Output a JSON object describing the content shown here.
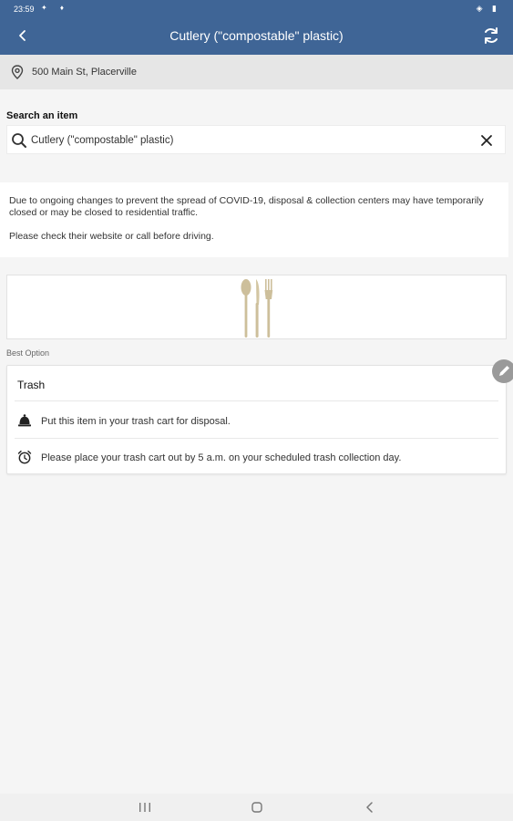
{
  "status": {
    "time": "23:59",
    "left_icons": "✦ ♦",
    "right_icons": "◈ ▮"
  },
  "header": {
    "title": "Cutlery (\"compostable\" plastic)",
    "back_icon": "back-arrow-icon",
    "refresh_icon": "refresh-icon",
    "background": "#3f6596"
  },
  "location": {
    "address": "500 Main St, Placerville",
    "icon": "location-pin-icon"
  },
  "search": {
    "label": "Search an item",
    "value": "Cutlery (\"compostable\" plastic)",
    "placeholder": "Search an item"
  },
  "notice": {
    "line1": "Due to ongoing changes to prevent the spread of COVID-19, disposal & collection centers may have temporarily closed or may be closed to residential traffic.",
    "line2": "Please check their website or call before driving."
  },
  "item": {
    "image_icon": "cutlery-icon"
  },
  "best_option": {
    "label": "Best Option",
    "title": "Trash",
    "rows": [
      {
        "icon": "bell-icon",
        "text": "Put this item in your trash cart for disposal."
      },
      {
        "icon": "alarm-clock-icon",
        "text": "Please place your trash cart out by 5 a.m. on your scheduled trash collection day."
      }
    ]
  },
  "navbar": {
    "recent_icon": "recent-apps-icon",
    "home_icon": "home-icon",
    "back_icon": "nav-back-icon"
  }
}
